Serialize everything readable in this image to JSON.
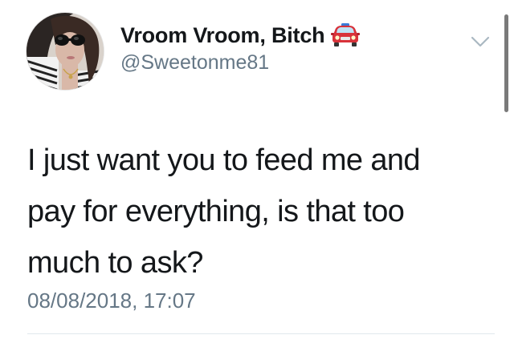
{
  "tweet": {
    "author": {
      "display_name": "Vroom Vroom, Bitch",
      "emoji_icon": "red-car-icon",
      "handle": "@Sweetonme81",
      "avatar": "profile-photo"
    },
    "text_lines": [
      "I just want you to feed me and",
      "pay for everything, is that too",
      "much to ask?"
    ],
    "timestamp": "08/08/2018, 17:07",
    "menu_icon": "chevron-down-icon"
  },
  "colors": {
    "text": "#14171a",
    "secondary": "#657786",
    "divider": "#e1e8ed",
    "car": "#d8323a"
  }
}
